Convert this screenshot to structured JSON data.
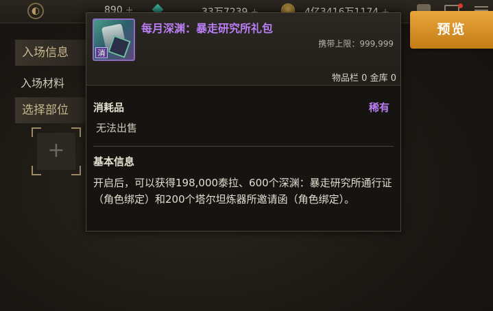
{
  "topbar": {
    "currency1": "890",
    "currency2": "33万7239",
    "currency3": "4亿3416万1174",
    "plus": "+",
    "icons": [
      "logo-icon",
      "gem-icon",
      "gold-coin-icon",
      "bag-icon",
      "mail-icon",
      "menu-icon"
    ]
  },
  "preview_button": "预览",
  "left_panel": {
    "entry_info": "入场信息",
    "entry_material": "入场材料",
    "select_part": "选择部位",
    "slot_plus": "+"
  },
  "tooltip": {
    "item_name": "每月深渊：暴走研究所礼包",
    "item_badge": "消",
    "carry_limit": "携带上限：999,999",
    "storage": "物品栏 0 金库 0",
    "type": "消耗品",
    "rarity": "稀有",
    "sell": "无法出售",
    "basic_info": "基本信息",
    "description": "开启后，可以获得198,000泰拉、600个深渊：暴走研究所通行证（角色绑定）和200个塔尔坦炼器所邀请函（角色绑定）。"
  },
  "colors": {
    "rarity_purple": "#b97ef4",
    "preview_orange": "#e19a2e"
  }
}
